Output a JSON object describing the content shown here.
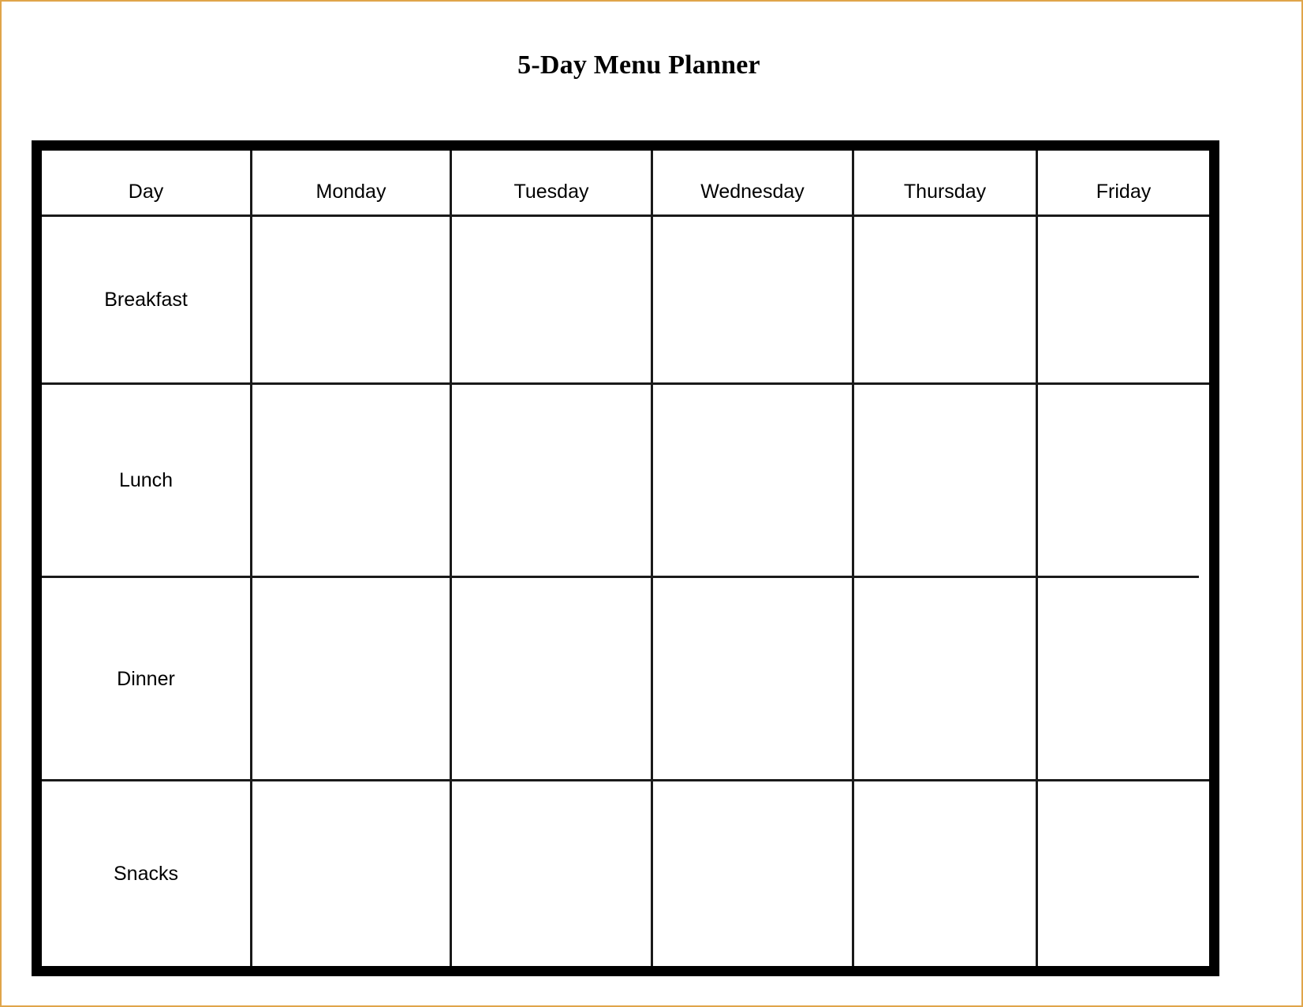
{
  "document": {
    "title": "5-Day Menu Planner",
    "page_border_color": "#e0a54a",
    "frame_color": "#000000",
    "rule_color": "#1a1a1a",
    "text_color": "#000000"
  },
  "table": {
    "columns": [
      {
        "key": "day",
        "label": "Day"
      },
      {
        "key": "monday",
        "label": "Monday"
      },
      {
        "key": "tuesday",
        "label": "Tuesday"
      },
      {
        "key": "wednesday",
        "label": "Wednesday"
      },
      {
        "key": "thursday",
        "label": "Thursday"
      },
      {
        "key": "friday",
        "label": "Friday"
      }
    ],
    "rows": [
      {
        "key": "breakfast",
        "label": "Breakfast",
        "cells": [
          "",
          "",
          "",
          "",
          ""
        ]
      },
      {
        "key": "lunch",
        "label": "Lunch",
        "cells": [
          "",
          "",
          "",
          "",
          ""
        ]
      },
      {
        "key": "dinner",
        "label": "Dinner",
        "cells": [
          "",
          "",
          "",
          "",
          ""
        ]
      },
      {
        "key": "snacks",
        "label": "Snacks",
        "cells": [
          "",
          "",
          "",
          "",
          ""
        ]
      }
    ]
  }
}
